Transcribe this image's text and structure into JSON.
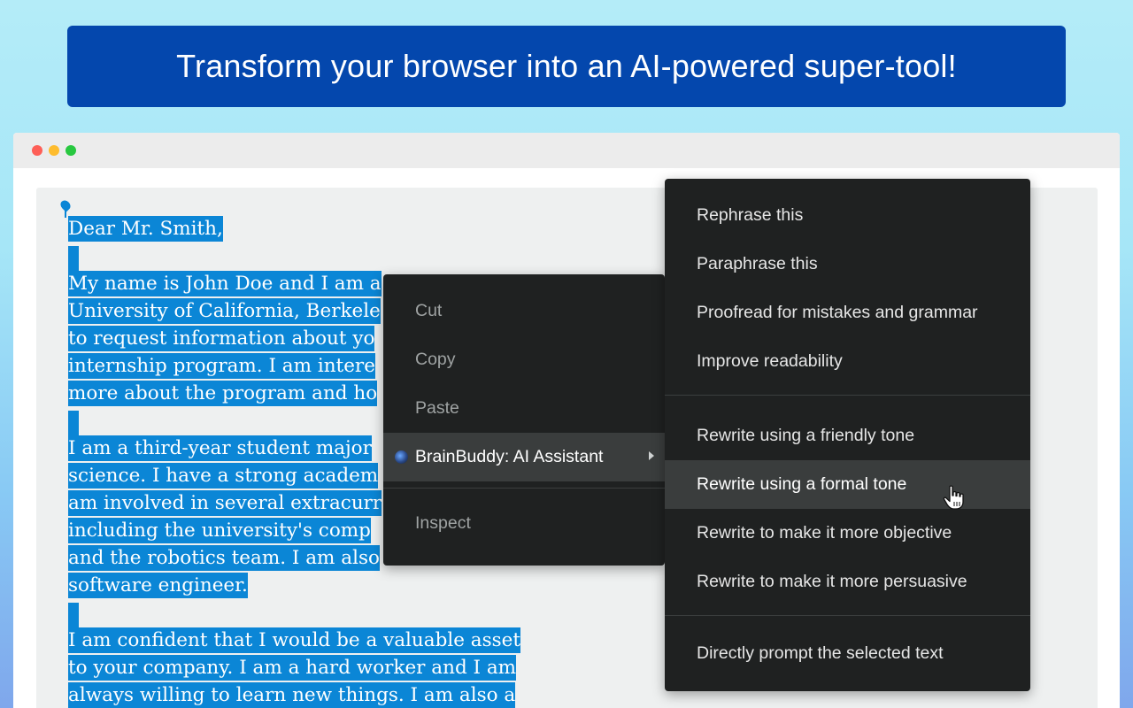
{
  "banner": {
    "headline": "Transform your browser into an AI-powered super-tool!"
  },
  "window": {
    "controls": [
      "close",
      "minimize",
      "maximize"
    ]
  },
  "document": {
    "greeting": "Dear Mr. Smith,",
    "paragraph1": [
      "My name is John Doe and I am a",
      "University of California, Berkele",
      "to request information about yo",
      "internship program. I am intere",
      "more about the program and ho"
    ],
    "paragraph2": [
      "I am a third-year student major",
      "science. I have a strong academ",
      "am involved in several extracurr",
      "including the university's comp",
      "and the robotics team. I am also",
      "software engineer."
    ],
    "paragraph3": [
      "I am confident that I would be a valuable asset",
      "to your company. I am a hard worker and I am",
      "always willing to learn new things. I am also a"
    ]
  },
  "context_menu": {
    "items": [
      "Cut",
      "Copy",
      "Paste"
    ],
    "extension": "BrainBuddy: AI Assistant",
    "inspect": "Inspect"
  },
  "submenu": {
    "group1": [
      "Rephrase this",
      "Paraphrase this",
      "Proofread for mistakes and grammar",
      "Improve readability"
    ],
    "group2": [
      "Rewrite using a friendly tone",
      "Rewrite using a formal tone",
      "Rewrite to make it more objective",
      "Rewrite to make it more persuasive"
    ],
    "group3": [
      "Directly prompt the selected text"
    ],
    "hovered": "Rewrite using a formal tone"
  },
  "colors": {
    "banner": "#0447ad",
    "selection": "#0b86d6",
    "menu_bg": "#1f2121"
  }
}
